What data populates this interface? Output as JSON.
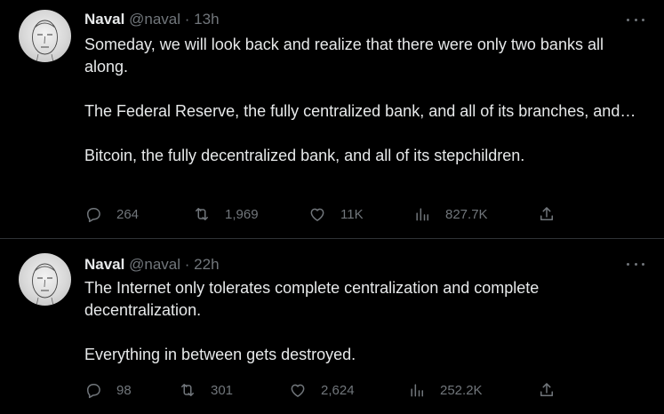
{
  "tweets": [
    {
      "name": "Naval",
      "handle": "@naval",
      "dot": "·",
      "time": "13h",
      "paragraphs": [
        "Someday, we will look back and realize that there were only two banks all along.",
        "The Federal Reserve, the fully centralized bank, and all of its branches, and…",
        "Bitcoin, the fully decentralized bank, and all of its stepchildren."
      ],
      "replies": "264",
      "retweets": "1,969",
      "likes": "11K",
      "views": "827.7K"
    },
    {
      "name": "Naval",
      "handle": "@naval",
      "dot": "·",
      "time": "22h",
      "paragraphs": [
        "The Internet only tolerates complete centralization and complete decentralization.",
        "Everything in between gets destroyed."
      ],
      "replies": "98",
      "retweets": "301",
      "likes": "2,624",
      "views": "252.2K"
    }
  ],
  "colors": {
    "background": "#000000",
    "text": "#e7e9ea",
    "secondary": "#71767b",
    "divider": "#2f3336"
  },
  "icons": [
    "avatar",
    "more-icon",
    "reply-icon",
    "retweet-icon",
    "like-icon",
    "views-icon",
    "share-icon"
  ]
}
